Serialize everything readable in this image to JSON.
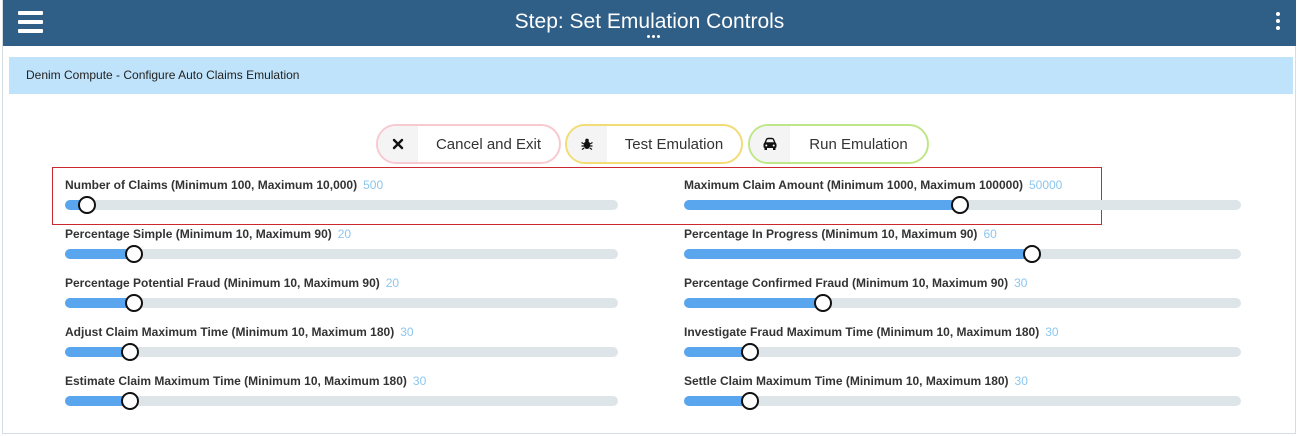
{
  "header": {
    "title": "Step: Set Emulation Controls"
  },
  "breadcrumb": {
    "text": "Denim Compute - Configure Auto Claims Emulation"
  },
  "buttons": {
    "cancel": "Cancel and Exit",
    "test": "Test Emulation",
    "run": "Run Emulation"
  },
  "icons": {
    "menu": "hamburger-menu-icon",
    "more": "vertical-dots-icon",
    "handle": "horizontal-dots-icon",
    "cancel": "close-x-icon",
    "test": "bug-icon",
    "run": "car-icon"
  },
  "colors": {
    "header_bg": "#2f5e87",
    "breadcrumb_bg": "#bfe3fb",
    "slider_fill": "#59a6ee",
    "value_text": "#8cc6ef",
    "highlight_border": "#c9292f"
  },
  "controls": [
    {
      "label": "Number of Claims (Minimum 100, Maximum 10,000)",
      "value": "500",
      "level": 0.04
    },
    {
      "label": "Maximum Claim Amount (Minimum 1000, Maximum 100000)",
      "value": "50000",
      "level": 0.495
    },
    {
      "label": "Percentage Simple (Minimum 10, Maximum 90)",
      "value": "20",
      "level": 0.125
    },
    {
      "label": "Percentage In Progress (Minimum 10, Maximum 90)",
      "value": "60",
      "level": 0.625
    },
    {
      "label": "Percentage Potential Fraud (Minimum 10, Maximum 90)",
      "value": "20",
      "level": 0.125
    },
    {
      "label": "Percentage Confirmed Fraud (Minimum 10, Maximum 90)",
      "value": "30",
      "level": 0.25
    },
    {
      "label": "Adjust Claim Maximum Time (Minimum 10, Maximum 180)",
      "value": "30",
      "level": 0.118
    },
    {
      "label": "Investigate Fraud Maximum Time (Minimum 10, Maximum 180)",
      "value": "30",
      "level": 0.118
    },
    {
      "label": "Estimate Claim Maximum Time (Minimum 10, Maximum 180)",
      "value": "30",
      "level": 0.118
    },
    {
      "label": "Settle Claim Maximum Time (Minimum 10, Maximum 180)",
      "value": "30",
      "level": 0.118
    }
  ]
}
